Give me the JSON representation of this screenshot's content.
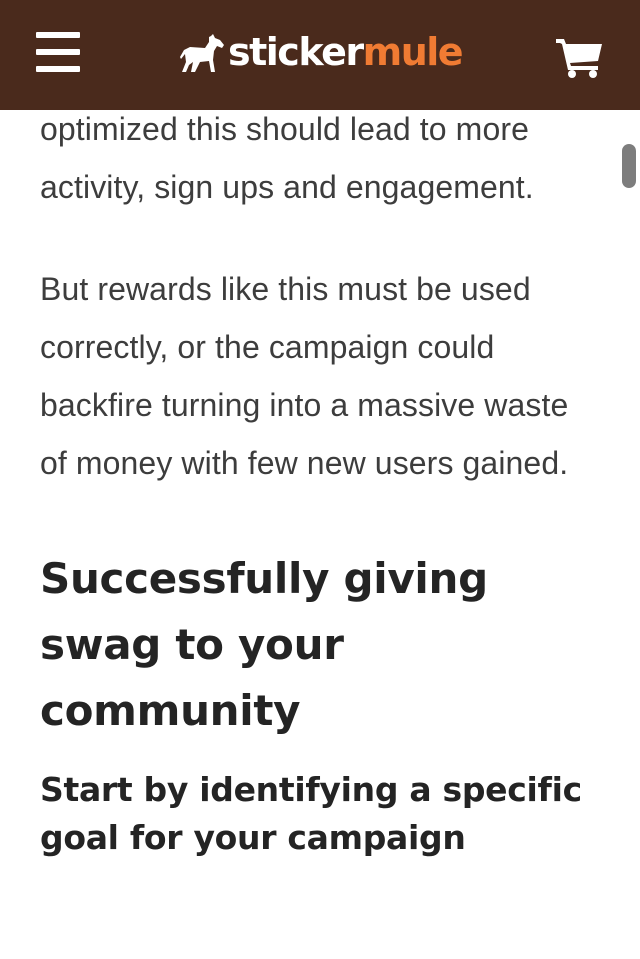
{
  "header": {
    "logo_word1": "sticker",
    "logo_word2": "mule",
    "background_color": "#4a2a1c",
    "accent_color": "#f07b33",
    "menu_icon": "hamburger-menu-icon",
    "cart_icon": "shopping-cart-icon",
    "logo_icon": "mule-logo-icon"
  },
  "article": {
    "paragraphs": [
      "optimized this should lead to more activity, sign ups and engagement.",
      "But rewards like this must be used correctly, or the campaign could backfire turning into a massive waste of money with few new users gained."
    ],
    "heading": "Successfully giving swag to your community",
    "subheading": "Start by identifying a specific goal for your campaign"
  }
}
